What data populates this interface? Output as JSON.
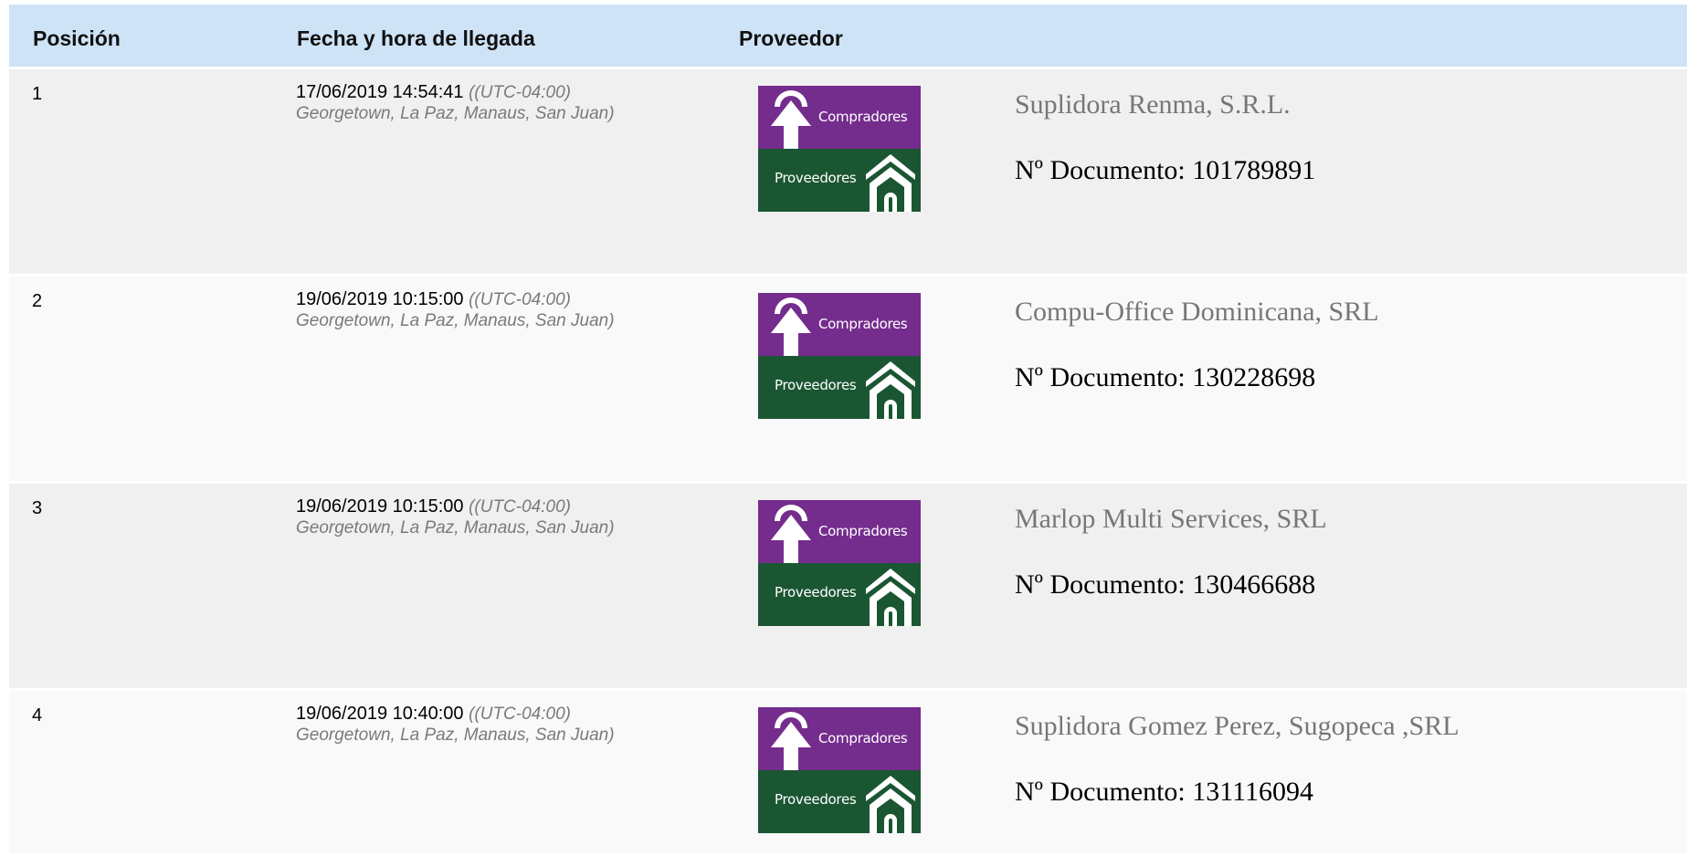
{
  "table": {
    "headers": {
      "posicion": "Posición",
      "fecha": "Fecha y hora de llegada",
      "proveedor": "Proveedor"
    },
    "logo": {
      "top_label": "Compradores",
      "bottom_label": "Proveedores",
      "colors": {
        "top": "#742c8d",
        "bottom": "#1b5633"
      }
    },
    "doc_prefix": "Nº Documento:",
    "rows": [
      {
        "position": "1",
        "datetime": "17/06/2019 14:54:41",
        "tz_offset": "((UTC-04:00)",
        "tz_cities": "Georgetown, La Paz, Manaus, San Juan)",
        "supplier_name": "Suplidora Renma, S.R.L.",
        "document_number": "101789891"
      },
      {
        "position": "2",
        "datetime": "19/06/2019 10:15:00",
        "tz_offset": "((UTC-04:00)",
        "tz_cities": "Georgetown, La Paz, Manaus, San Juan)",
        "supplier_name": "Compu-Office Dominicana, SRL",
        "document_number": "130228698"
      },
      {
        "position": "3",
        "datetime": "19/06/2019 10:15:00",
        "tz_offset": "((UTC-04:00)",
        "tz_cities": "Georgetown, La Paz, Manaus, San Juan)",
        "supplier_name": "Marlop Multi Services, SRL",
        "document_number": "130466688"
      },
      {
        "position": "4",
        "datetime": "19/06/2019 10:40:00",
        "tz_offset": "((UTC-04:00)",
        "tz_cities": "Georgetown, La Paz, Manaus, San Juan)",
        "supplier_name": "Suplidora Gomez Perez, Sugopeca ,SRL",
        "document_number": "131116094"
      }
    ]
  }
}
